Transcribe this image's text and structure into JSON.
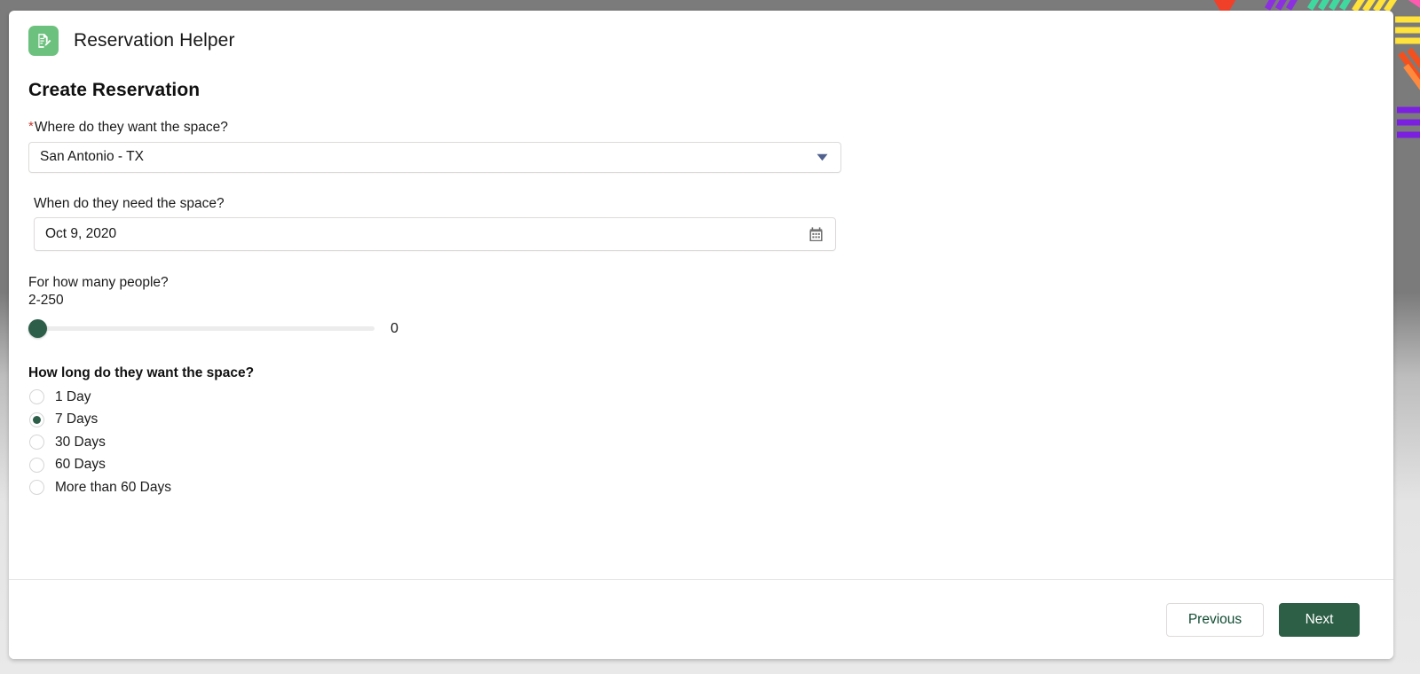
{
  "app": {
    "icon": "document-edit-icon",
    "icon_bg": "#6dc17f",
    "title": "Reservation Helper"
  },
  "page": {
    "title": "Create Reservation"
  },
  "form": {
    "location": {
      "required_marker": "*",
      "label": "Where do they want the space?",
      "value": "San Antonio - TX",
      "icon": "chevron-down-icon"
    },
    "date": {
      "label": "When do they need the space?",
      "value": "Oct 9, 2020",
      "icon": "calendar-icon"
    },
    "people": {
      "label": "For how many people?",
      "range": "2-250",
      "value": "0",
      "min": 2,
      "max": 250,
      "thumb_color": "#2d5e49",
      "track_color": "#ececec"
    },
    "duration": {
      "legend": "How long do they want the space?",
      "selected": "7 Days",
      "options": [
        {
          "label": "1 Day",
          "selected": false
        },
        {
          "label": "7 Days",
          "selected": true
        },
        {
          "label": "30 Days",
          "selected": false
        },
        {
          "label": "60 Days",
          "selected": false
        },
        {
          "label": "More than 60 Days",
          "selected": false
        }
      ]
    }
  },
  "footer": {
    "previous_label": "Previous",
    "next_label": "Next",
    "next_color": "#2c5f45"
  }
}
